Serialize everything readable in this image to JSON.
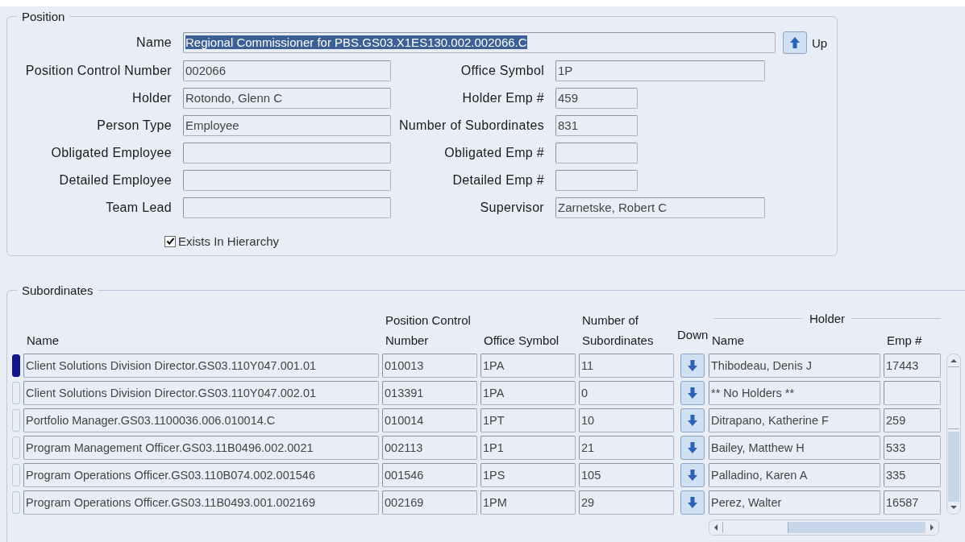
{
  "position": {
    "title": "Position",
    "name": {
      "label": "Name",
      "value": "Regional Commissioner for PBS.GS03.X1ES130.002.002066.C",
      "text_selected": true
    },
    "up_button": {
      "label": "Up"
    },
    "left_fields": [
      {
        "label": "Position Control Number",
        "value": "002066"
      },
      {
        "label": "Holder",
        "value": "Rotondo, Glenn C"
      },
      {
        "label": "Person Type",
        "value": "Employee"
      },
      {
        "label": "Obligated Employee"
      },
      {
        "label": "Detailed Employee"
      },
      {
        "label": "Team Lead"
      }
    ],
    "right_fields": [
      {
        "label": "Office Symbol",
        "value": "1P"
      },
      {
        "label": "Holder Emp #",
        "value": "459"
      },
      {
        "label": "Number of Subordinates",
        "value": "831"
      },
      {
        "label": "Obligated Emp #"
      },
      {
        "label": "Detailed Emp #"
      },
      {
        "label": "Supervisor",
        "value": "Zarnetske, Robert C"
      }
    ],
    "exists_in_hierarchy": {
      "label": "Exists In Hierarchy",
      "checked": true
    }
  },
  "subordinates": {
    "title": "Subordinates",
    "columns": [
      "Name",
      "Position Control Number",
      "Office Symbol",
      "Number of Subordinates",
      "Down"
    ],
    "holder_group": "Holder",
    "holder_columns": [
      "Name",
      "Emp #"
    ],
    "rows": [
      {
        "selected": true,
        "name": "Client Solutions Division Director.GS03.110Y047.001.01",
        "pcn": "010013",
        "office": "1PA",
        "subs": "11",
        "holder": "Thibodeau, Denis J",
        "emp": "17443"
      },
      {
        "selected": false,
        "name": "Client Solutions Division Director.GS03.110Y047.002.01",
        "pcn": "013391",
        "office": "1PA",
        "subs": "0",
        "holder": "** No Holders **"
      },
      {
        "selected": false,
        "name": "Portfolio Manager.GS03.1100036.006.010014.C",
        "pcn": "010014",
        "office": "1PT",
        "subs": "10",
        "holder": "Ditrapano, Katherine F",
        "emp": "259"
      },
      {
        "selected": false,
        "name": "Program Management Officer.GS03.11B0496.002.0021",
        "pcn": "002113",
        "office": "1P1",
        "subs": "21",
        "holder": "Bailey, Matthew H",
        "emp": "533"
      },
      {
        "selected": false,
        "name": "Program Operations Officer.GS03.110B074.002.001546",
        "pcn": "001546",
        "office": "1PS",
        "subs": "105",
        "holder": "Palladino, Karen A",
        "emp": "335"
      },
      {
        "selected": false,
        "name": "Program Operations Officer.GS03.11B0493.001.002169",
        "pcn": "002169",
        "office": "1PM",
        "subs": "29",
        "holder": "Perez, Walter",
        "emp": "16587"
      }
    ]
  }
}
